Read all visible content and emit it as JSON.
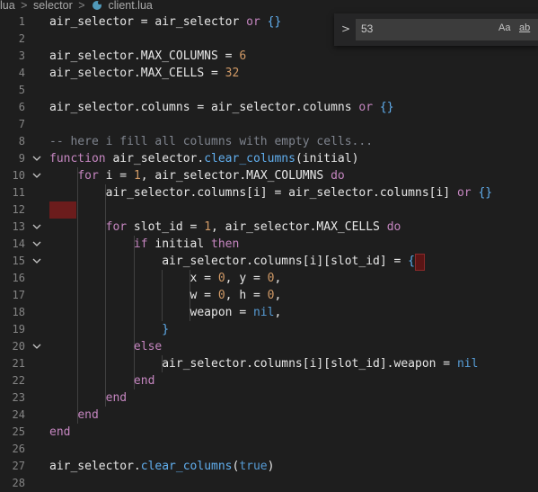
{
  "breadcrumb": {
    "items": [
      "lua",
      "selector",
      "client.lua"
    ],
    "separator": ">"
  },
  "find": {
    "toggle": ">",
    "value": "53",
    "match_case": "Aa",
    "whole_word": "ab"
  },
  "colors": {
    "background": "#1e1e1e",
    "keyword": "#c586c0",
    "function": "#61afef",
    "number": "#d19a66",
    "comment": "#7f848e",
    "error_highlight": "#6b1c1c"
  },
  "editor": {
    "lines": [
      {
        "n": "1",
        "text": "air_selector = air_selector or {}"
      },
      {
        "n": "2",
        "text": ""
      },
      {
        "n": "3",
        "text": "air_selector.MAX_COLUMNS = 6"
      },
      {
        "n": "4",
        "text": "air_selector.MAX_CELLS = 32"
      },
      {
        "n": "5",
        "text": ""
      },
      {
        "n": "6",
        "text": "air_selector.columns = air_selector.columns or {}"
      },
      {
        "n": "7",
        "text": ""
      },
      {
        "n": "8",
        "text": "-- here i fill all columns with empty cells..."
      },
      {
        "n": "9",
        "text": "function air_selector.clear_columns(initial)"
      },
      {
        "n": "10",
        "text": "    for i = 1, air_selector.MAX_COLUMNS do"
      },
      {
        "n": "11",
        "text": "        air_selector.columns[i] = air_selector.columns[i] or {}"
      },
      {
        "n": "12",
        "text": ""
      },
      {
        "n": "13",
        "text": "        for slot_id = 1, air_selector.MAX_CELLS do"
      },
      {
        "n": "14",
        "text": "            if initial then"
      },
      {
        "n": "15",
        "text": "                air_selector.columns[i][slot_id] = {"
      },
      {
        "n": "16",
        "text": "                    x = 0, y = 0,"
      },
      {
        "n": "17",
        "text": "                    w = 0, h = 0,"
      },
      {
        "n": "18",
        "text": "                    weapon = nil,"
      },
      {
        "n": "19",
        "text": "                }"
      },
      {
        "n": "20",
        "text": "            else"
      },
      {
        "n": "21",
        "text": "                air_selector.columns[i][slot_id].weapon = nil"
      },
      {
        "n": "22",
        "text": "            end"
      },
      {
        "n": "23",
        "text": "        end"
      },
      {
        "n": "24",
        "text": "    end"
      },
      {
        "n": "25",
        "text": "end"
      },
      {
        "n": "26",
        "text": ""
      },
      {
        "n": "27",
        "text": "air_selector.clear_columns(true)"
      },
      {
        "n": "28",
        "text": ""
      }
    ],
    "fold_icon": "chevron-down-icon",
    "fold_lines": [
      "9",
      "10",
      "13",
      "14",
      "15",
      "20"
    ]
  }
}
